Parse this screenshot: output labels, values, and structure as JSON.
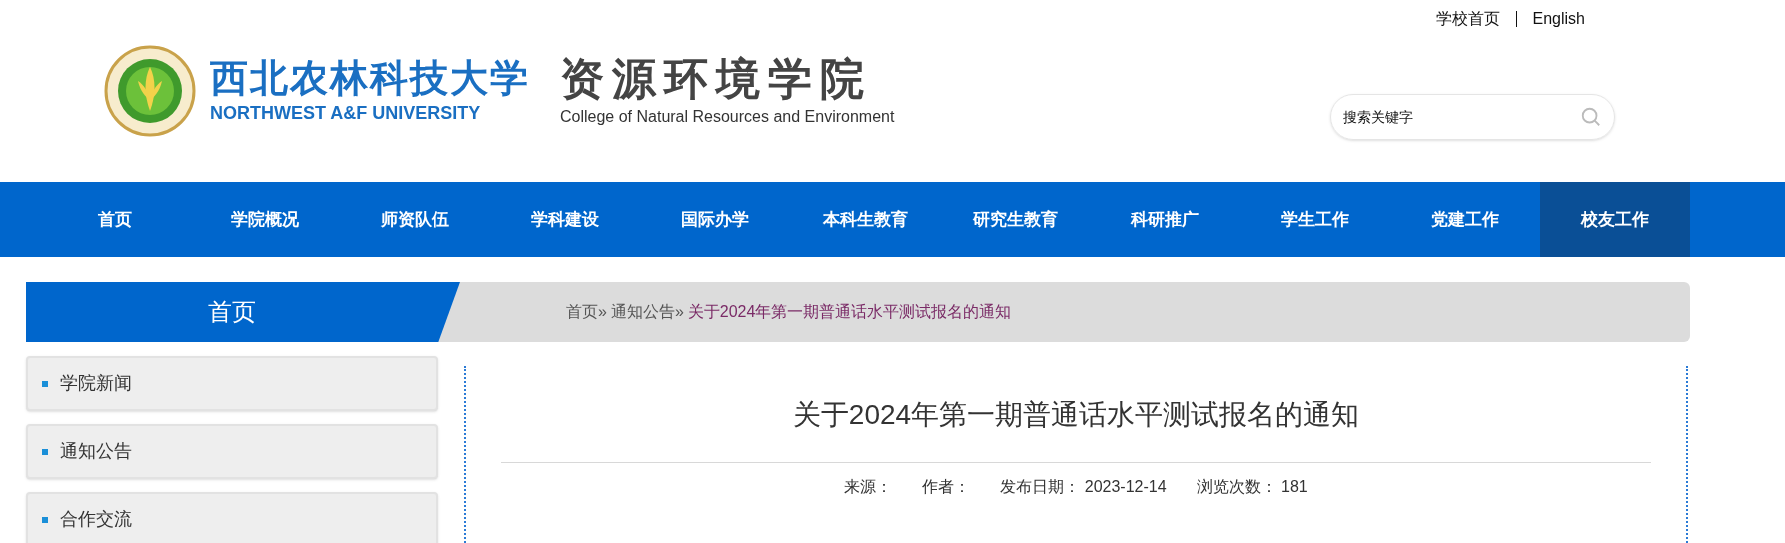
{
  "top_links": [
    "学校首页",
    "English"
  ],
  "logo": {
    "university_cn": "西北农林科技大学",
    "university_en": "NORTHWEST A&F UNIVERSITY",
    "college_cn": "资源环境学院",
    "college_en": "College of Natural Resources and Environment"
  },
  "search": {
    "placeholder": "搜索关键字"
  },
  "nav": [
    {
      "label": "首页",
      "selected": false
    },
    {
      "label": "学院概况",
      "selected": false
    },
    {
      "label": "师资队伍",
      "selected": false
    },
    {
      "label": "学科建设",
      "selected": false
    },
    {
      "label": "国际办学",
      "selected": false
    },
    {
      "label": "本科生教育",
      "selected": false
    },
    {
      "label": "研究生教育",
      "selected": false
    },
    {
      "label": "科研推广",
      "selected": false
    },
    {
      "label": "学生工作",
      "selected": false
    },
    {
      "label": "党建工作",
      "selected": false
    },
    {
      "label": "校友工作",
      "selected": true
    }
  ],
  "section_title": "首页",
  "breadcrumb": [
    {
      "label": "首页»",
      "current": false
    },
    {
      "label": "通知公告»",
      "current": false
    },
    {
      "label": "关于2024年第一期普通话水平测试报名的通知",
      "current": true
    }
  ],
  "sidebar": [
    "学院新闻",
    "通知公告",
    "合作交流"
  ],
  "article": {
    "title": "关于2024年第一期普通话水平测试报名的通知",
    "meta": [
      {
        "label": "来源："
      },
      {
        "label": "作者："
      },
      {
        "label": "发布日期：",
        "value": "2023-12-14"
      },
      {
        "label": "浏览次数：",
        "value": "181"
      }
    ]
  }
}
